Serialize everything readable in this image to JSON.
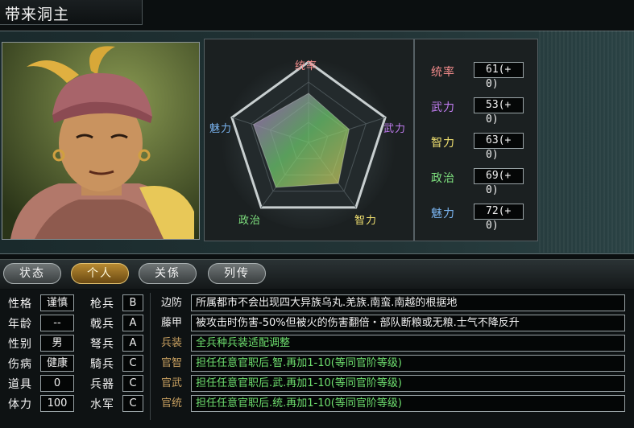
{
  "header": {
    "title": "带来洞主"
  },
  "colors": {
    "tongshuai": "#f08a8a",
    "wuli": "#c07cf0",
    "zhili": "#f0e070",
    "zhengzhi": "#7ee07e",
    "meili": "#7ab4f0",
    "skill_green": "#6fe06f",
    "skill_dim": "#c8a060"
  },
  "radar": {
    "labels": {
      "top": "统率",
      "right": "武力",
      "bottom_right": "智力",
      "bottom_left": "政治",
      "left": "魅力"
    },
    "values": {
      "统率": 61,
      "武力": 53,
      "智力": 63,
      "政治": 69,
      "魅力": 72
    }
  },
  "stats": [
    {
      "label": "统率",
      "value": "61(+ 0)"
    },
    {
      "label": "武力",
      "value": "53(+ 0)"
    },
    {
      "label": "智力",
      "value": "63(+ 0)"
    },
    {
      "label": "政治",
      "value": "69(+ 0)"
    },
    {
      "label": "魅力",
      "value": "72(+ 0)"
    }
  ],
  "tabs": [
    {
      "label": "状态"
    },
    {
      "label": "个人"
    },
    {
      "label": "关係"
    },
    {
      "label": "列传"
    }
  ],
  "profile": [
    {
      "label": "性格",
      "value": "谨慎"
    },
    {
      "label": "年龄",
      "value": "--"
    },
    {
      "label": "性别",
      "value": "男"
    },
    {
      "label": "伤病",
      "value": "健康"
    },
    {
      "label": "道具",
      "value": "0"
    },
    {
      "label": "体力",
      "value": "100"
    }
  ],
  "aptitude": [
    {
      "label": "枪兵",
      "value": "B"
    },
    {
      "label": "戟兵",
      "value": "A"
    },
    {
      "label": "弩兵",
      "value": "A"
    },
    {
      "label": "騎兵",
      "value": "C"
    },
    {
      "label": "兵器",
      "value": "C"
    },
    {
      "label": "水军",
      "value": "C"
    }
  ],
  "skills": [
    {
      "name": "边防",
      "desc": "所属都市不会出现四大异族乌丸.羌族.南蛮.南越的根据地"
    },
    {
      "name": "藤甲",
      "desc": "被攻击时伤害-50%但被火的伤害翻倍・部队断粮或无粮.士气不降反升"
    },
    {
      "name": "兵装",
      "desc": "全兵种兵装适配调整"
    },
    {
      "name": "官智",
      "desc": "担任任意官职后.智.再加1-10(等同官阶等级)"
    },
    {
      "name": "官武",
      "desc": "担任任意官职后.武.再加1-10(等同官阶等级)"
    },
    {
      "name": "官统",
      "desc": "担任任意官职后.统.再加1-10(等同官阶等级)"
    }
  ]
}
